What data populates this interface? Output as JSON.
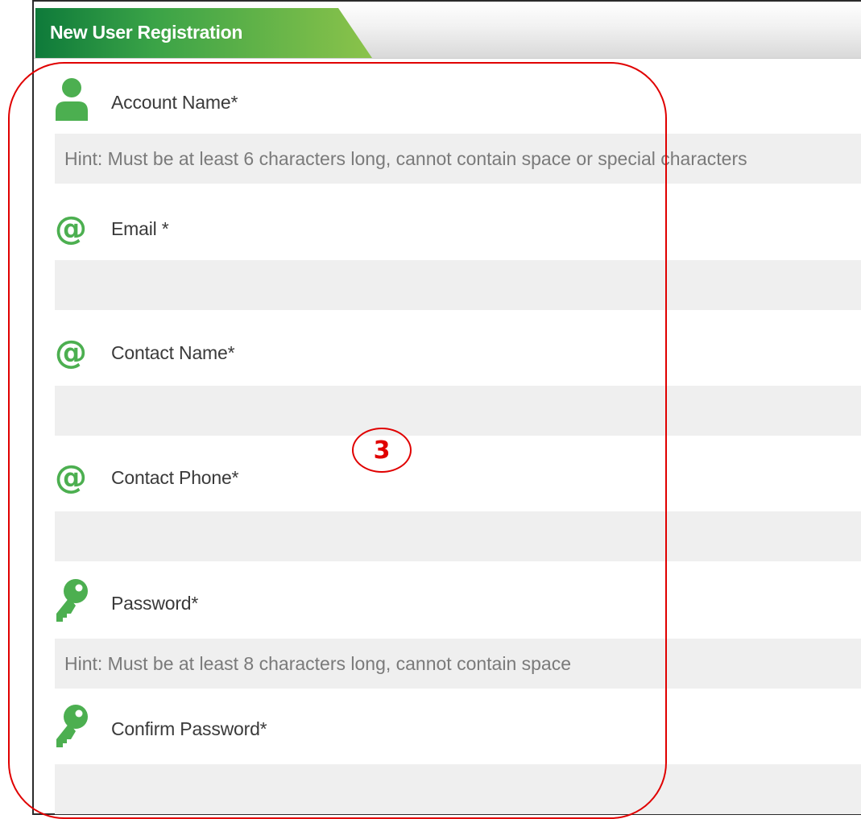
{
  "form": {
    "title": "New User Registration",
    "fields": {
      "account_name": {
        "label": "Account Name*",
        "placeholder": "Hint: Must be at least 6 characters long, cannot contain space or special characters",
        "icon": "user-icon"
      },
      "email": {
        "label": "Email *",
        "placeholder": "",
        "icon": "at-icon"
      },
      "contact_name": {
        "label": "Contact Name*",
        "placeholder": "",
        "icon": "at-icon"
      },
      "contact_phone": {
        "label": "Contact Phone*",
        "placeholder": "",
        "icon": "at-icon"
      },
      "password": {
        "label": "Password*",
        "placeholder": "Hint: Must be at least 8 characters long, cannot contain space",
        "icon": "key-icon"
      },
      "confirm_password": {
        "label": "Confirm Password*",
        "placeholder": "",
        "icon": "key-icon"
      }
    }
  },
  "annotation": {
    "marker": "3"
  },
  "colors": {
    "accent_green": "#4caf50",
    "header_dark_green": "#0e7a3a",
    "annotation_red": "#e00000"
  }
}
